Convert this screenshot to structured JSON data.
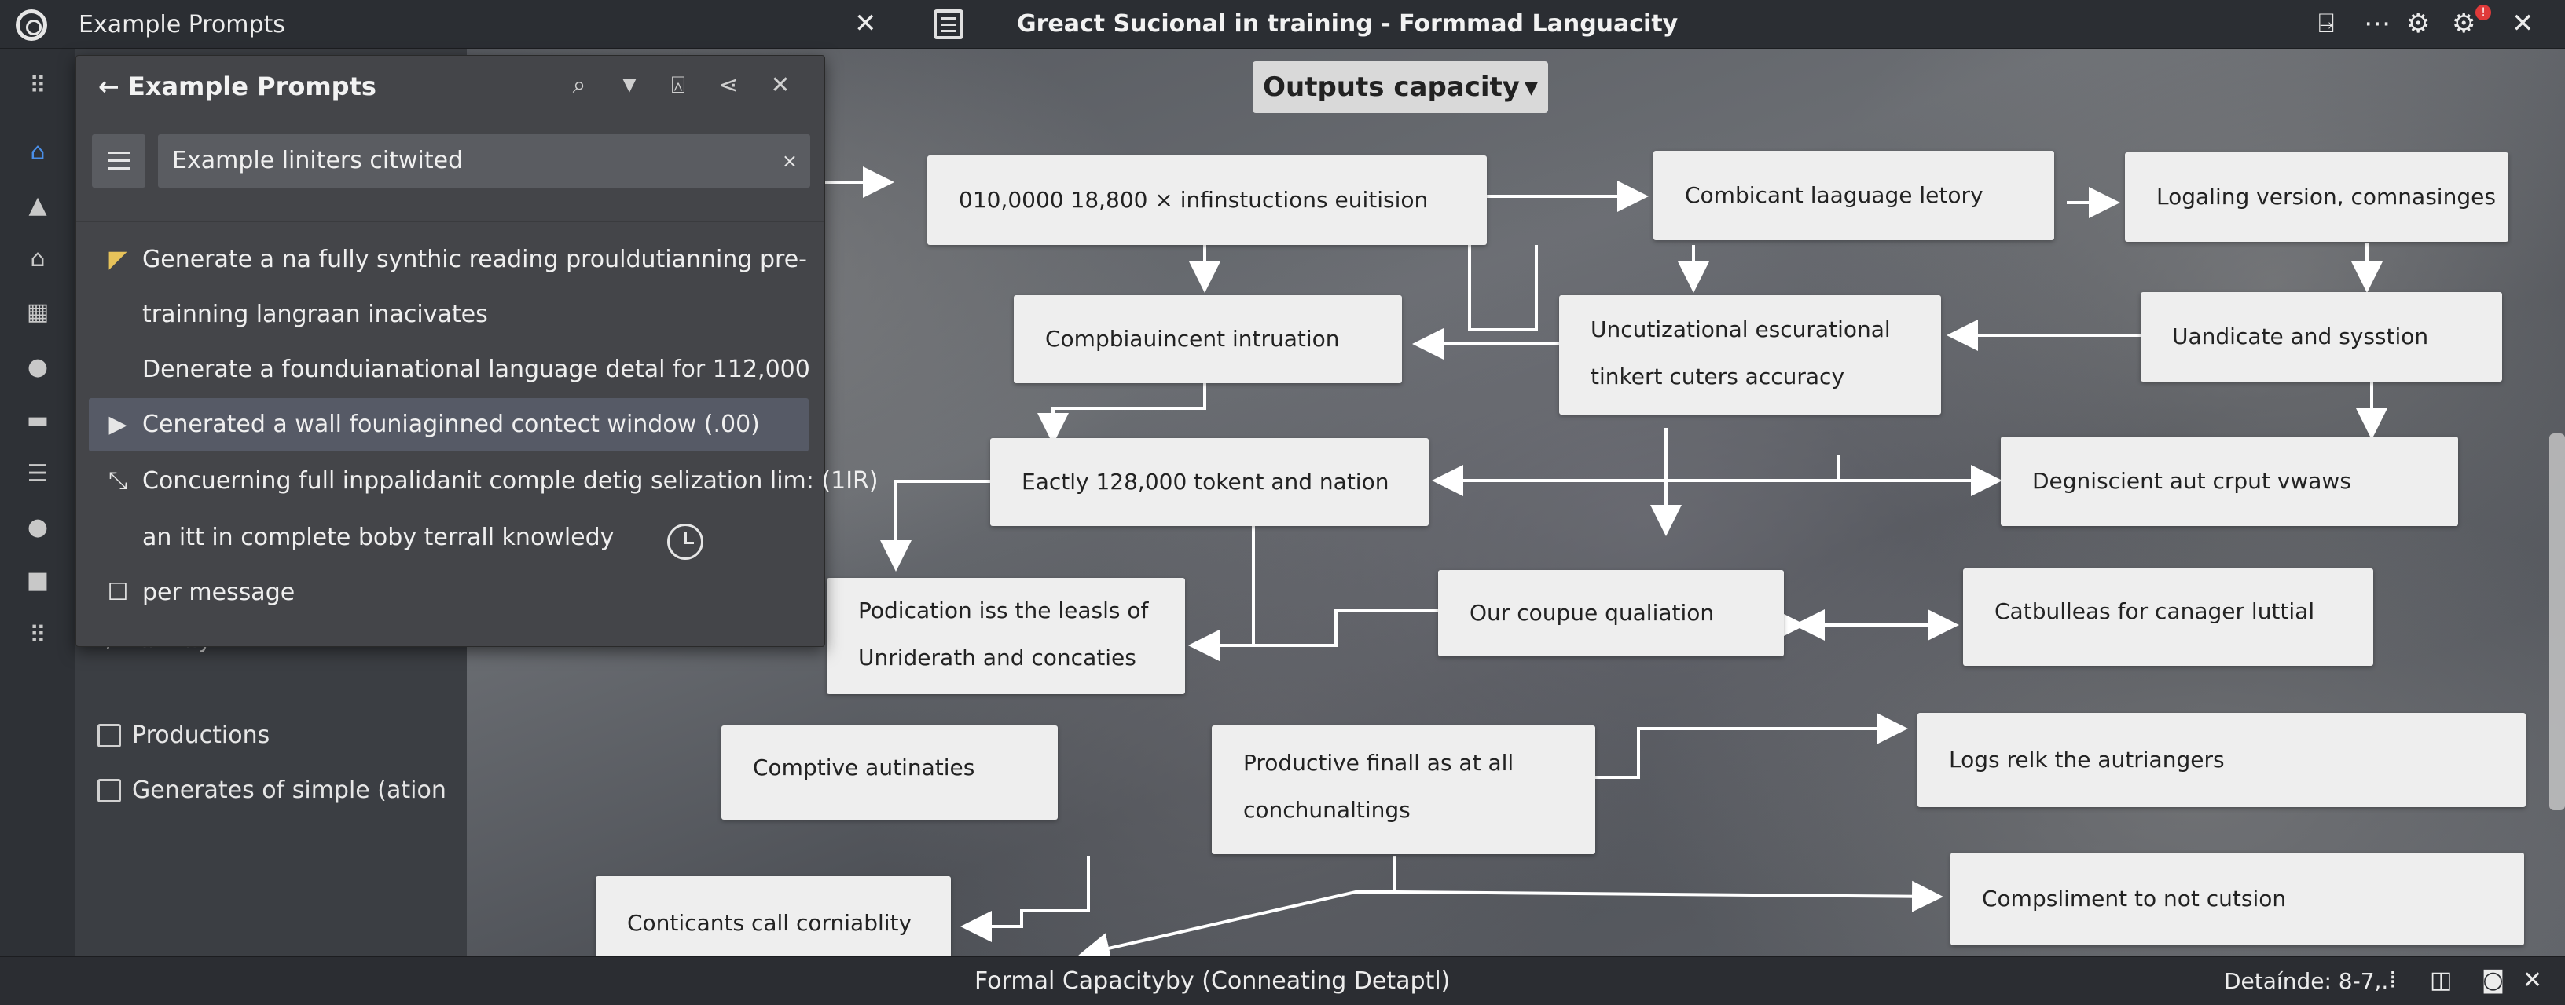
{
  "titlebar": {
    "tab_title": "Example Prompts",
    "tab_close": "✕",
    "window_title": "Greact Sucional in training - Formmad Languacity",
    "badge": "!"
  },
  "popup": {
    "title": "Example Prompts",
    "back_arrow": "←",
    "search_value": "Example liniters citwited",
    "clear": "×",
    "items": [
      {
        "icon": "pin",
        "text": "Generate a na fully synthic reading prouldutianning pre-"
      },
      {
        "icon": "",
        "text": "trainning langraan inacivates"
      },
      {
        "icon": "",
        "text": "Denerate a founduianational language detal for 112,000"
      },
      {
        "icon": "play",
        "text": "Cenerated a wall founiaginned contect window (.00)"
      },
      {
        "icon": "magic-wand",
        "text": "Concuerning full inppalidanit comple detig selization lim: (1IR)"
      },
      {
        "icon": "",
        "text": "an itt in complete boby terrall knowledy"
      },
      {
        "icon": "clipboard",
        "text": "per message"
      }
    ]
  },
  "leftpanel": {
    "hidden_row": "K/ wiim          ilytD  < *",
    "checkboxes": [
      {
        "label": "Productions",
        "checked": false
      },
      {
        "label": "Generates of simple (ation",
        "checked": false
      }
    ]
  },
  "canvas": {
    "dropdown_label": "Outputs capacity",
    "nodes": {
      "n1": [
        "010,0000 18,800 × infinstuctions euitision"
      ],
      "n2": [
        "Combicant laaguage letory"
      ],
      "n3": [
        "Logaling version, comnasinges"
      ],
      "n4": [
        "Compbiauincent intruation"
      ],
      "n5": [
        "Uncutizational escurational",
        "tinkert cuters accuracy"
      ],
      "n6": [
        "Uandicate and sysstion"
      ],
      "n7": [
        "Eactly 128,000 tokent  and nation"
      ],
      "n8": [
        "Degniscient aut crput vwaws"
      ],
      "n9": [
        "Podication iss the leasls of",
        "Unriderath and concaties"
      ],
      "n10": [
        "Our coupue qualiation"
      ],
      "n11": [
        "Catbulleas for canager luttial"
      ],
      "n12": [
        "Comptive autinaties"
      ],
      "n13": [
        "Productive finall as at all",
        "conchunaltings"
      ],
      "n14": [
        "Logs relk the autriangers"
      ],
      "n15": [
        "Conticants call corniablity"
      ],
      "n16": [
        "Compsliment to  not cutsion"
      ]
    }
  },
  "statusbar": {
    "center": "Formal Capacityby (Conneating Detaptl)",
    "right": "Detaínde: 8-7,."
  }
}
